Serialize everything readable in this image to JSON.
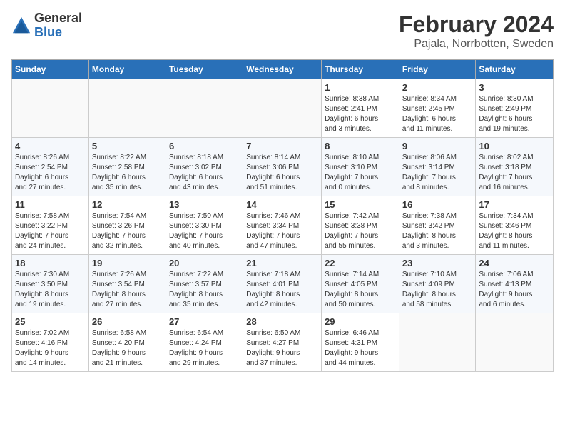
{
  "logo": {
    "general": "General",
    "blue": "Blue"
  },
  "header": {
    "month_year": "February 2024",
    "location": "Pajala, Norrbotten, Sweden"
  },
  "weekdays": [
    "Sunday",
    "Monday",
    "Tuesday",
    "Wednesday",
    "Thursday",
    "Friday",
    "Saturday"
  ],
  "weeks": [
    [
      {
        "day": "",
        "info": ""
      },
      {
        "day": "",
        "info": ""
      },
      {
        "day": "",
        "info": ""
      },
      {
        "day": "",
        "info": ""
      },
      {
        "day": "1",
        "info": "Sunrise: 8:38 AM\nSunset: 2:41 PM\nDaylight: 6 hours\nand 3 minutes."
      },
      {
        "day": "2",
        "info": "Sunrise: 8:34 AM\nSunset: 2:45 PM\nDaylight: 6 hours\nand 11 minutes."
      },
      {
        "day": "3",
        "info": "Sunrise: 8:30 AM\nSunset: 2:49 PM\nDaylight: 6 hours\nand 19 minutes."
      }
    ],
    [
      {
        "day": "4",
        "info": "Sunrise: 8:26 AM\nSunset: 2:54 PM\nDaylight: 6 hours\nand 27 minutes."
      },
      {
        "day": "5",
        "info": "Sunrise: 8:22 AM\nSunset: 2:58 PM\nDaylight: 6 hours\nand 35 minutes."
      },
      {
        "day": "6",
        "info": "Sunrise: 8:18 AM\nSunset: 3:02 PM\nDaylight: 6 hours\nand 43 minutes."
      },
      {
        "day": "7",
        "info": "Sunrise: 8:14 AM\nSunset: 3:06 PM\nDaylight: 6 hours\nand 51 minutes."
      },
      {
        "day": "8",
        "info": "Sunrise: 8:10 AM\nSunset: 3:10 PM\nDaylight: 7 hours\nand 0 minutes."
      },
      {
        "day": "9",
        "info": "Sunrise: 8:06 AM\nSunset: 3:14 PM\nDaylight: 7 hours\nand 8 minutes."
      },
      {
        "day": "10",
        "info": "Sunrise: 8:02 AM\nSunset: 3:18 PM\nDaylight: 7 hours\nand 16 minutes."
      }
    ],
    [
      {
        "day": "11",
        "info": "Sunrise: 7:58 AM\nSunset: 3:22 PM\nDaylight: 7 hours\nand 24 minutes."
      },
      {
        "day": "12",
        "info": "Sunrise: 7:54 AM\nSunset: 3:26 PM\nDaylight: 7 hours\nand 32 minutes."
      },
      {
        "day": "13",
        "info": "Sunrise: 7:50 AM\nSunset: 3:30 PM\nDaylight: 7 hours\nand 40 minutes."
      },
      {
        "day": "14",
        "info": "Sunrise: 7:46 AM\nSunset: 3:34 PM\nDaylight: 7 hours\nand 47 minutes."
      },
      {
        "day": "15",
        "info": "Sunrise: 7:42 AM\nSunset: 3:38 PM\nDaylight: 7 hours\nand 55 minutes."
      },
      {
        "day": "16",
        "info": "Sunrise: 7:38 AM\nSunset: 3:42 PM\nDaylight: 8 hours\nand 3 minutes."
      },
      {
        "day": "17",
        "info": "Sunrise: 7:34 AM\nSunset: 3:46 PM\nDaylight: 8 hours\nand 11 minutes."
      }
    ],
    [
      {
        "day": "18",
        "info": "Sunrise: 7:30 AM\nSunset: 3:50 PM\nDaylight: 8 hours\nand 19 minutes."
      },
      {
        "day": "19",
        "info": "Sunrise: 7:26 AM\nSunset: 3:54 PM\nDaylight: 8 hours\nand 27 minutes."
      },
      {
        "day": "20",
        "info": "Sunrise: 7:22 AM\nSunset: 3:57 PM\nDaylight: 8 hours\nand 35 minutes."
      },
      {
        "day": "21",
        "info": "Sunrise: 7:18 AM\nSunset: 4:01 PM\nDaylight: 8 hours\nand 42 minutes."
      },
      {
        "day": "22",
        "info": "Sunrise: 7:14 AM\nSunset: 4:05 PM\nDaylight: 8 hours\nand 50 minutes."
      },
      {
        "day": "23",
        "info": "Sunrise: 7:10 AM\nSunset: 4:09 PM\nDaylight: 8 hours\nand 58 minutes."
      },
      {
        "day": "24",
        "info": "Sunrise: 7:06 AM\nSunset: 4:13 PM\nDaylight: 9 hours\nand 6 minutes."
      }
    ],
    [
      {
        "day": "25",
        "info": "Sunrise: 7:02 AM\nSunset: 4:16 PM\nDaylight: 9 hours\nand 14 minutes."
      },
      {
        "day": "26",
        "info": "Sunrise: 6:58 AM\nSunset: 4:20 PM\nDaylight: 9 hours\nand 21 minutes."
      },
      {
        "day": "27",
        "info": "Sunrise: 6:54 AM\nSunset: 4:24 PM\nDaylight: 9 hours\nand 29 minutes."
      },
      {
        "day": "28",
        "info": "Sunrise: 6:50 AM\nSunset: 4:27 PM\nDaylight: 9 hours\nand 37 minutes."
      },
      {
        "day": "29",
        "info": "Sunrise: 6:46 AM\nSunset: 4:31 PM\nDaylight: 9 hours\nand 44 minutes."
      },
      {
        "day": "",
        "info": ""
      },
      {
        "day": "",
        "info": ""
      }
    ]
  ]
}
